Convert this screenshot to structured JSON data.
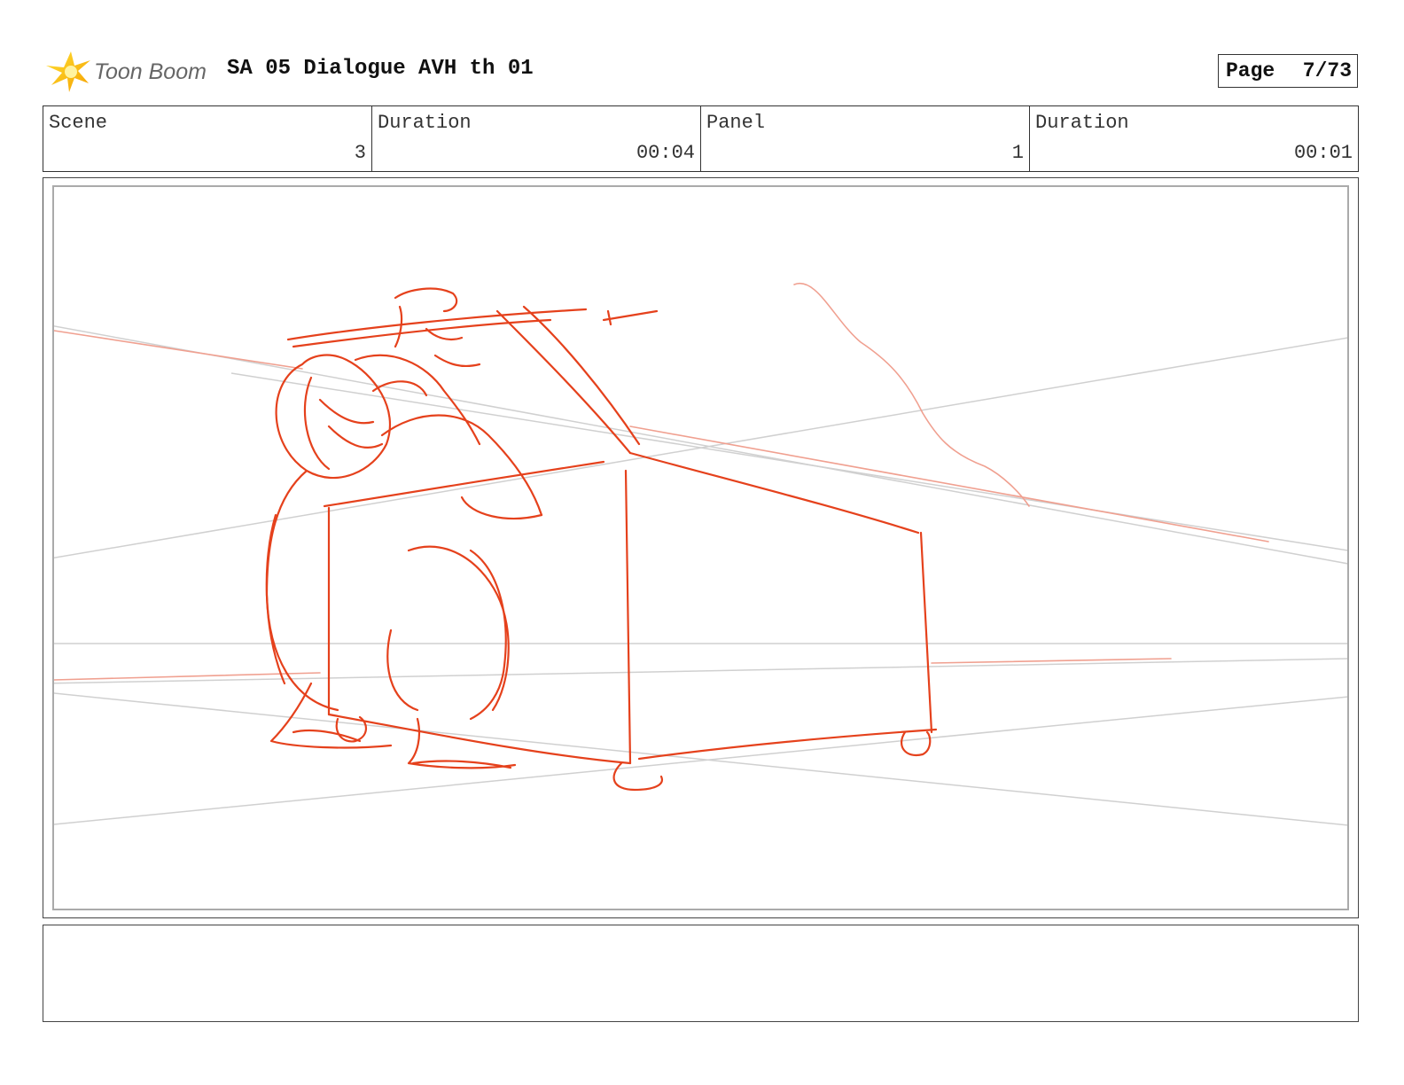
{
  "header": {
    "logo_text": "Toon Boom",
    "logo_icon": "starburst-logo-icon",
    "title": "SA 05 Dialogue AVH th 01",
    "page_label": "Page",
    "page_value": "7/73"
  },
  "info": {
    "scene_label": "Scene",
    "scene_value": "3",
    "scene_duration_label": "Duration",
    "scene_duration_value": "00:04",
    "panel_label": "Panel",
    "panel_value": "1",
    "panel_duration_label": "Duration",
    "panel_duration_value": "00:01"
  },
  "sketch": {
    "stroke_color": "#e5411c",
    "faint_stroke_color": "#f0a090",
    "guide_color": "#d0d0d0"
  },
  "notes": {
    "text": ""
  }
}
